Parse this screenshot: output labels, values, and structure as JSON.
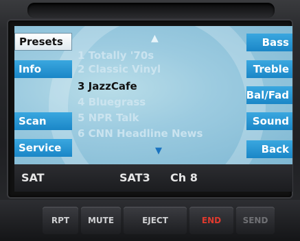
{
  "left_buttons": {
    "presets": "Presets",
    "info": "Info",
    "scan": "Scan",
    "service": "Service"
  },
  "right_buttons": {
    "bass": "Bass",
    "treble": "Treble",
    "balfad": "Bal/Fad",
    "sound": "Sound",
    "back": "Back"
  },
  "channel_list": {
    "up_arrow": "▲",
    "down_arrow": "▼",
    "items": [
      {
        "num": "1",
        "name": "Totally '70s"
      },
      {
        "num": "2",
        "name": "Classic Vinyl"
      },
      {
        "num": "3",
        "name": "JazzCafe"
      },
      {
        "num": "4",
        "name": "Bluegrass"
      },
      {
        "num": "5",
        "name": "NPR Talk"
      },
      {
        "num": "6",
        "name": "CNN Headline News"
      }
    ]
  },
  "status_bar": {
    "source": "SAT",
    "band": "SAT3",
    "channel": "Ch 8"
  },
  "hardware_buttons": {
    "rpt": "RPT",
    "mute": "MUTE",
    "eject": "EJECT",
    "end": "END",
    "send": "SEND"
  },
  "colors": {
    "softkey": "#2596d4",
    "screen": "#9ccbe0",
    "end_text": "#e03a2e"
  }
}
